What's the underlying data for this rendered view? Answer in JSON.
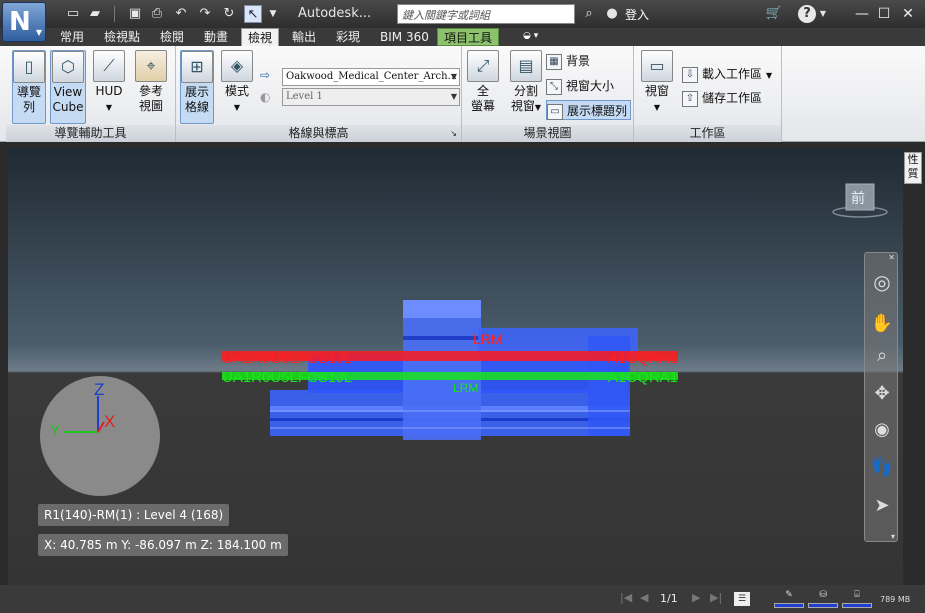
{
  "app": {
    "logo": "N",
    "title": "Autodesk..."
  },
  "search": {
    "placeholder": "鍵入關鍵字或詞組"
  },
  "account": {
    "login_label": "登入"
  },
  "tabs": [
    "常用",
    "檢視點",
    "檢閱",
    "動畫",
    "檢視",
    "輸出",
    "彩現",
    "BIM 360",
    "項目工具"
  ],
  "ribbon": {
    "nav_aids": {
      "label": "導覽輔助工具",
      "buttons": [
        "導覽\n列",
        "View\nCube",
        "HUD",
        "參考\n視圖"
      ]
    },
    "grids": {
      "label": "格線與標高",
      "show_grid": "展示\n格線",
      "mode": "模式",
      "model_select": "Oakwood_Medical_Center_Arch...",
      "level_select": "Level 1"
    },
    "scene_view": {
      "label": "場景視圖",
      "fullscreen": "全\n螢幕",
      "split": "分割\n視窗",
      "background": "背景",
      "window_size": "視窗大小",
      "show_title": "展示標題列"
    },
    "workspace": {
      "label": "工作區",
      "window": "視窗",
      "load": "載入工作區",
      "save": "儲存工作區"
    }
  },
  "viewport": {
    "axes": {
      "x": "X",
      "y": "Y",
      "z": "Z"
    },
    "viewcube_label": "前",
    "info_element": "R1(140)-RM(1) : Level 4 (168)",
    "info_coords": "X: 40.785 m  Y: -86.097 m  Z: 184.100 m",
    "side_tab": "性質"
  },
  "status": {
    "page": "1/1",
    "memory": "789 MB"
  },
  "colors": {
    "model_blue": "#2f5cff",
    "grid_red": "#ff1a1a",
    "grid_green": "#19e619",
    "accent": "#8cc26b"
  }
}
